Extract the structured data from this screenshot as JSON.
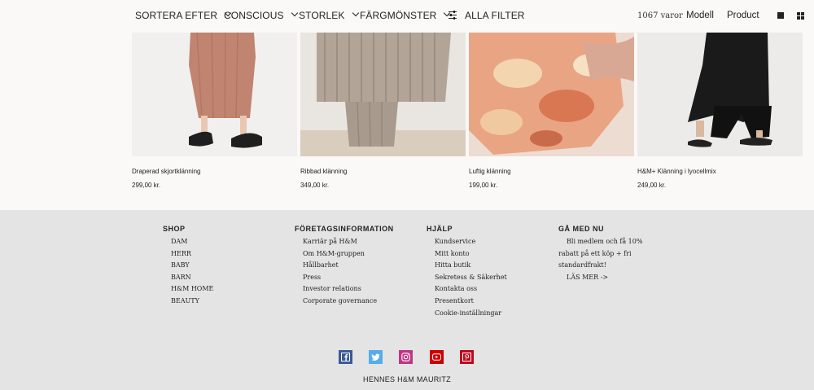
{
  "filters": {
    "sort_label": "SORTERA EFTER",
    "conscious_label": "CONSCIOUS",
    "size_label": "STORLEK",
    "color_label": "FÄRGMÖNSTER",
    "all_filters_label": "ALLA FILTER",
    "count": "1067 varor",
    "model_label": "Modell",
    "product_label": "Product"
  },
  "products": [
    {
      "name": "Draperad skjortklänning",
      "price": "299,00 kr."
    },
    {
      "name": "Ribbad klänning",
      "price": "349,00 kr."
    },
    {
      "name": "Luftig klänning",
      "price": "199,00 kr."
    },
    {
      "name": "H&M+ Klänning i lyocellmix",
      "price": "249,00 kr."
    }
  ],
  "footer": {
    "shop": {
      "heading": "SHOP",
      "links": [
        "DAM",
        "HERR",
        "BABY",
        "BARN",
        "H&M HOME",
        "BEAUTY"
      ]
    },
    "company": {
      "heading": "FÖRETAGSINFORMATION",
      "links": [
        "Karriär på H&M",
        "Om H&M-gruppen",
        "Hållbarhet",
        "Press",
        "Investor relations",
        "Corporate governance"
      ]
    },
    "help": {
      "heading": "HJÄLP",
      "links": [
        "Kundservice",
        "Mitt konto",
        "Hitta butik",
        "Sekretess & Säkerhet",
        "Kontakta oss",
        "Presentkort",
        "Cookie-inställningar"
      ]
    },
    "join": {
      "heading": "GÅ MED NU",
      "text": "Bli medlem och få 10% rabatt på ett köp + fri standardfrakt!",
      "link": "LÄS MER ->"
    },
    "social": {
      "facebook_color": "#3b5998",
      "twitter_color": "#55acee",
      "instagram_color": "#c13584",
      "youtube_color": "#cc0000",
      "pinterest_color": "#bd081c"
    },
    "brand": "HENNES H&M MAURITZ"
  }
}
